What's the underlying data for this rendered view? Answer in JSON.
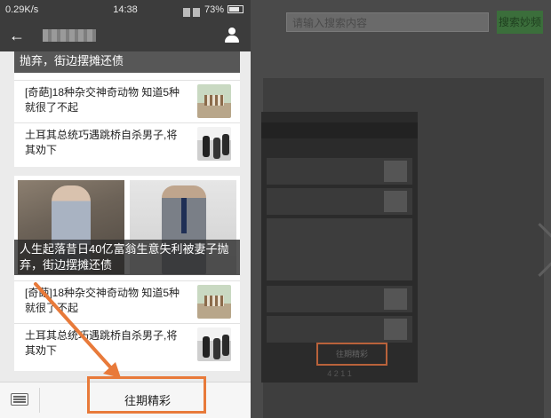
{
  "status_bar": {
    "speed": "0.29K/s",
    "time": "14:38",
    "battery": "73%"
  },
  "nav": {
    "title": "xxxxxx"
  },
  "card1": {
    "headline_tail": "抛弃，街边摆摊还债",
    "items": [
      {
        "text": "[奇葩]18种杂交神奇动物 知道5种就很了不起"
      },
      {
        "text": "土耳其总统巧遇跳桥自杀男子,将其劝下"
      }
    ]
  },
  "card2": {
    "headline": "人生起落昔日40亿富翁生意失利被妻子抛弃，街边摆摊还债",
    "items": [
      {
        "text": "[奇葩]18种杂交神奇动物 知道5种就很了不起"
      },
      {
        "text": "土耳其总统巧遇跳桥自杀男子,将其劝下"
      }
    ]
  },
  "bottom_bar": {
    "menu_label": "往期精彩"
  },
  "background": {
    "search_placeholder": "请输入搜索内容",
    "search_button": "搜索妙频",
    "phone_menu_label": "往期精彩",
    "phone_footer": "4 2 1 1"
  },
  "colors": {
    "highlight": "#e87a3a",
    "nav_bg": "#3c3c3c",
    "accent_green": "#3b6e3b"
  }
}
